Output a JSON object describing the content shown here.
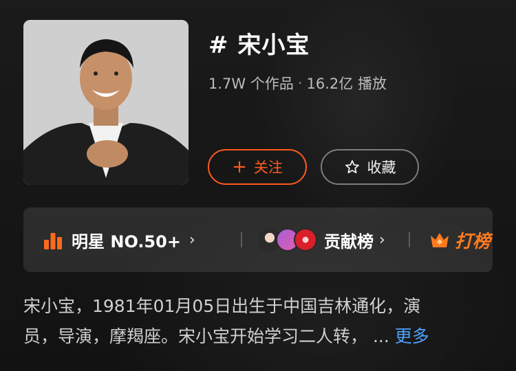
{
  "topic": {
    "title": "# 宋小宝",
    "works": "1.7W 个作品",
    "separator": "·",
    "plays": "16.2亿 播放"
  },
  "actions": {
    "follow_label": "关注",
    "follow_icon": "plus-icon",
    "favorite_label": "收藏",
    "favorite_icon": "star-outline-icon"
  },
  "ranking": {
    "star_rank": "明星 NO.50+",
    "star_icon": "bar-chart-icon",
    "contrib_label": "贡献榜",
    "contrib_avatars": 3,
    "hit_label": "打榜",
    "hit_icon": "crown-icon",
    "chevron": "›"
  },
  "description": {
    "line1": "宋小宝，1981年01月05日出生于中国吉林通化，演",
    "line2": "员，导演，摩羯座。宋小宝开始学习二人转，",
    "ellipsis": "...",
    "more_label": "更多"
  },
  "colors": {
    "accent": "#ff5b1f",
    "link": "#4da3ff",
    "hit": "#ff7a1f"
  }
}
